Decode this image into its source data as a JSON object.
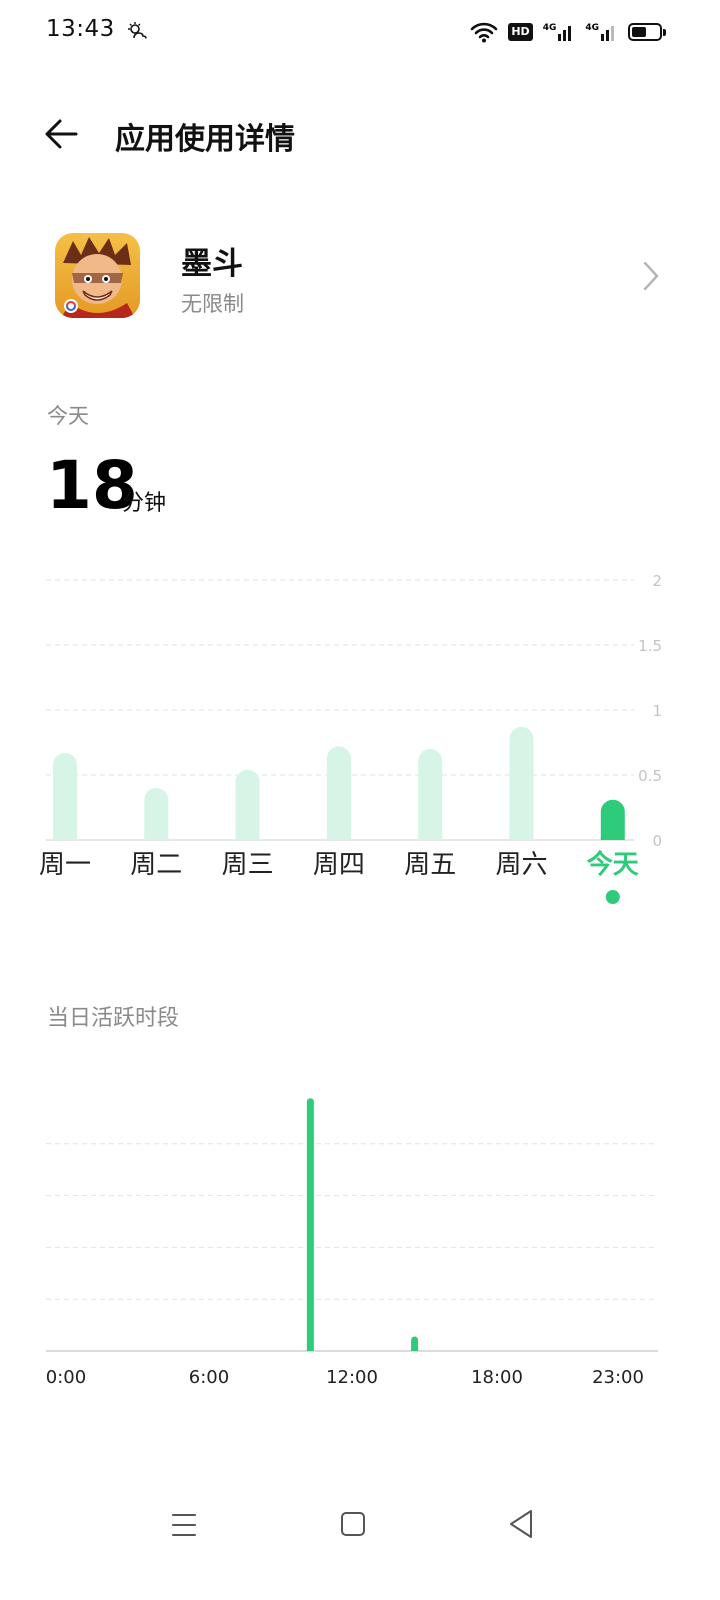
{
  "status_bar": {
    "time": "13:43",
    "hd_label": "HD",
    "net_1": "4G",
    "net_2": "4G",
    "battery_level": 0.55
  },
  "header": {
    "title": "应用使用详情"
  },
  "app": {
    "name": "墨斗",
    "restriction": "无限制"
  },
  "today": {
    "label": "今天",
    "value": "18",
    "unit": "分钟"
  },
  "active_section": {
    "title": "当日活跃时段"
  },
  "colors": {
    "accent": "#2ecc7a",
    "bar_light": "#d6f5e6",
    "grid": "#e2e2e2",
    "muted": "#8a8a8a"
  },
  "chart_data": [
    {
      "type": "bar",
      "title": "",
      "categories": [
        "周一",
        "周二",
        "周三",
        "周四",
        "周五",
        "周六",
        "今天"
      ],
      "values": [
        0.67,
        0.4,
        0.54,
        0.72,
        0.7,
        0.87,
        0.31
      ],
      "highlight_index": 6,
      "y_ticks": [
        "0",
        "0.5",
        "1",
        "1.5",
        "2"
      ],
      "ylim": [
        0,
        2
      ],
      "grid": true
    },
    {
      "type": "bar",
      "title": "当日活跃时段",
      "x_ticks": [
        "0:00",
        "6:00",
        "12:00",
        "18:00",
        "23:00"
      ],
      "xlim": [
        0,
        24
      ],
      "ylim": [
        0,
        1.25
      ],
      "points": [
        {
          "hour": 10.2,
          "value": 1.22
        },
        {
          "hour": 14.55,
          "value": 0.07
        }
      ],
      "grid": true
    }
  ]
}
